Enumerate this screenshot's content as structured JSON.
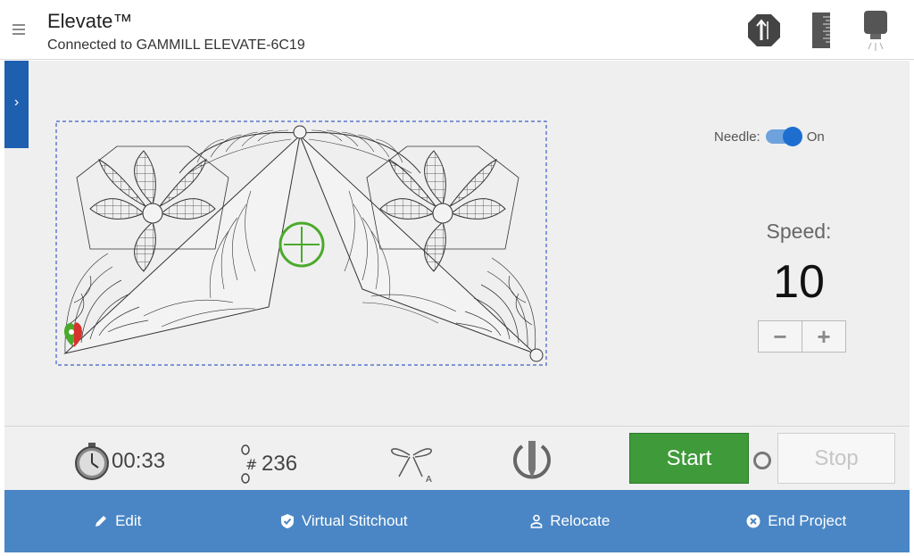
{
  "header": {
    "title": "Elevate™",
    "connection": "Connected to GAMMILL ELEVATE-6C19",
    "icons": [
      "menu-icon",
      "sensor-icon",
      "ruler-icon",
      "machine-icon"
    ]
  },
  "sidebar": {
    "toggle_glyph": "›"
  },
  "needle": {
    "label": "Needle:",
    "state": "On",
    "enabled": true
  },
  "speed": {
    "label": "Speed:",
    "value": "10",
    "decrement_glyph": "−",
    "increment_glyph": "+"
  },
  "status": {
    "time": "00:33",
    "stitch_count": "236",
    "stitch_symbol": "#",
    "tie_badge": "A"
  },
  "controls": {
    "start_label": "Start",
    "stop_label": "Stop"
  },
  "toolbar": {
    "edit_label": "Edit",
    "stitchout_label": "Virtual Stitchout",
    "relocate_label": "Relocate",
    "end_label": "End Project"
  },
  "colors": {
    "accent_blue": "#1e5fb0",
    "toolbar_blue": "#4a86c5",
    "start_green": "#3f9a3a",
    "crosshair_green": "#4aaa2c",
    "start_marker_red": "#d9322c"
  }
}
